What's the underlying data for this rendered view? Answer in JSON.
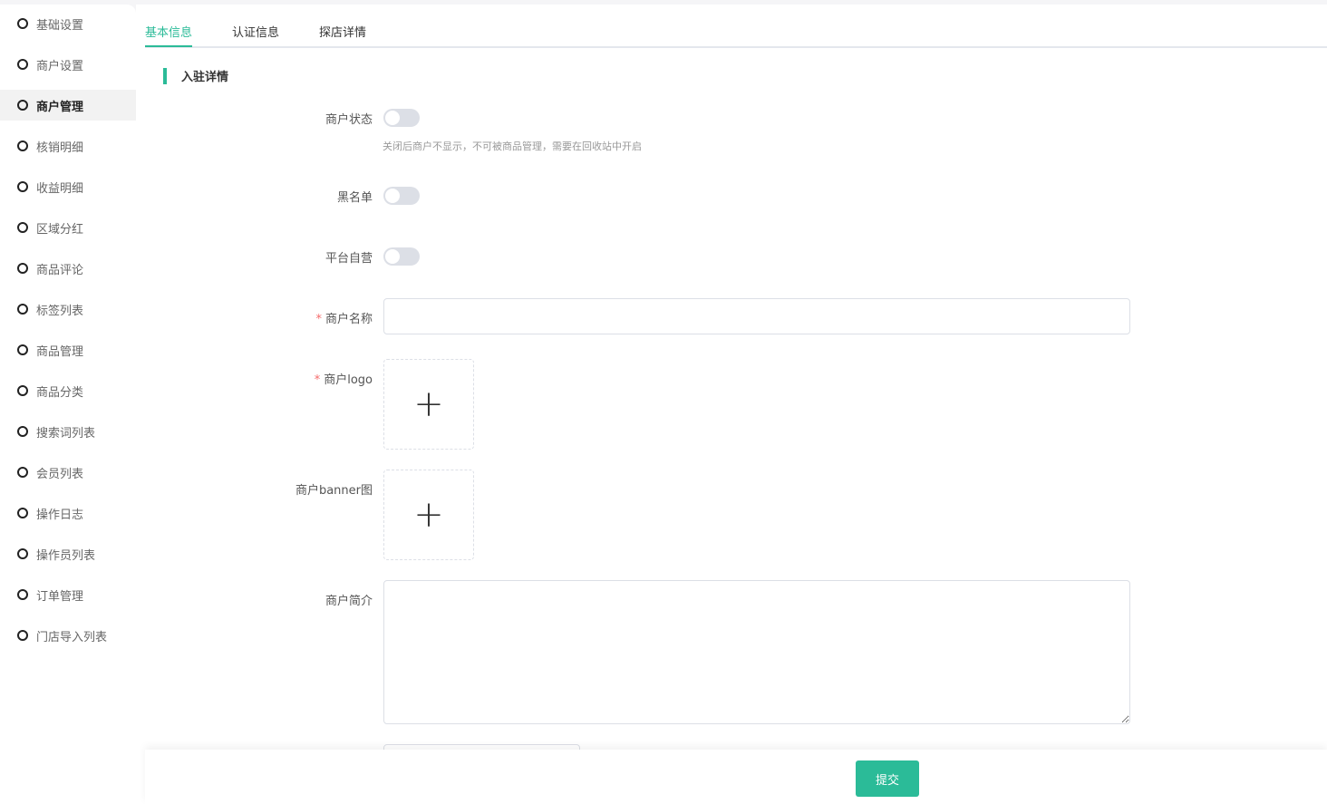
{
  "sidebar": {
    "items": [
      "基础设置",
      "商户设置",
      "商户管理",
      "核销明细",
      "收益明细",
      "区域分红",
      "商品评论",
      "标签列表",
      "商品管理",
      "商品分类",
      "搜索词列表",
      "会员列表",
      "操作日志",
      "操作员列表",
      "订单管理",
      "门店导入列表"
    ],
    "active": 2
  },
  "tabs": [
    "基本信息",
    "认证信息",
    "探店详情"
  ],
  "section": "入驻详情",
  "form": {
    "status_label": "商户状态",
    "status_hint": "关闭后商户不显示，不可被商品管理，需要在回收站中开启",
    "blacklist_label": "黑名单",
    "self_label": "平台自营",
    "name_label": "商户名称",
    "logo_label": "商户logo",
    "banner_label": "商户banner图",
    "intro_label": "商户简介",
    "required_mark": "*"
  },
  "submit": "提交"
}
